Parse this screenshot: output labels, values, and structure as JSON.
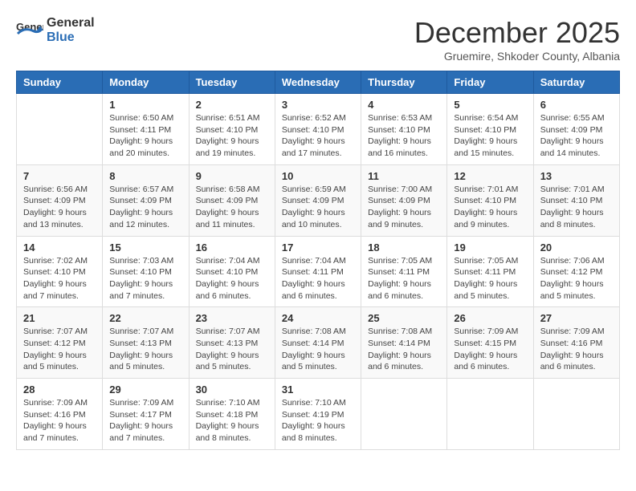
{
  "logo": {
    "general": "General",
    "blue": "Blue"
  },
  "title": "December 2025",
  "subtitle": "Gruemire, Shkoder County, Albania",
  "days_header": [
    "Sunday",
    "Monday",
    "Tuesday",
    "Wednesday",
    "Thursday",
    "Friday",
    "Saturday"
  ],
  "weeks": [
    [
      {
        "day": "",
        "info": ""
      },
      {
        "day": "1",
        "info": "Sunrise: 6:50 AM\nSunset: 4:11 PM\nDaylight: 9 hours\nand 20 minutes."
      },
      {
        "day": "2",
        "info": "Sunrise: 6:51 AM\nSunset: 4:10 PM\nDaylight: 9 hours\nand 19 minutes."
      },
      {
        "day": "3",
        "info": "Sunrise: 6:52 AM\nSunset: 4:10 PM\nDaylight: 9 hours\nand 17 minutes."
      },
      {
        "day": "4",
        "info": "Sunrise: 6:53 AM\nSunset: 4:10 PM\nDaylight: 9 hours\nand 16 minutes."
      },
      {
        "day": "5",
        "info": "Sunrise: 6:54 AM\nSunset: 4:10 PM\nDaylight: 9 hours\nand 15 minutes."
      },
      {
        "day": "6",
        "info": "Sunrise: 6:55 AM\nSunset: 4:09 PM\nDaylight: 9 hours\nand 14 minutes."
      }
    ],
    [
      {
        "day": "7",
        "info": "Sunrise: 6:56 AM\nSunset: 4:09 PM\nDaylight: 9 hours\nand 13 minutes."
      },
      {
        "day": "8",
        "info": "Sunrise: 6:57 AM\nSunset: 4:09 PM\nDaylight: 9 hours\nand 12 minutes."
      },
      {
        "day": "9",
        "info": "Sunrise: 6:58 AM\nSunset: 4:09 PM\nDaylight: 9 hours\nand 11 minutes."
      },
      {
        "day": "10",
        "info": "Sunrise: 6:59 AM\nSunset: 4:09 PM\nDaylight: 9 hours\nand 10 minutes."
      },
      {
        "day": "11",
        "info": "Sunrise: 7:00 AM\nSunset: 4:09 PM\nDaylight: 9 hours\nand 9 minutes."
      },
      {
        "day": "12",
        "info": "Sunrise: 7:01 AM\nSunset: 4:10 PM\nDaylight: 9 hours\nand 9 minutes."
      },
      {
        "day": "13",
        "info": "Sunrise: 7:01 AM\nSunset: 4:10 PM\nDaylight: 9 hours\nand 8 minutes."
      }
    ],
    [
      {
        "day": "14",
        "info": "Sunrise: 7:02 AM\nSunset: 4:10 PM\nDaylight: 9 hours\nand 7 minutes."
      },
      {
        "day": "15",
        "info": "Sunrise: 7:03 AM\nSunset: 4:10 PM\nDaylight: 9 hours\nand 7 minutes."
      },
      {
        "day": "16",
        "info": "Sunrise: 7:04 AM\nSunset: 4:10 PM\nDaylight: 9 hours\nand 6 minutes."
      },
      {
        "day": "17",
        "info": "Sunrise: 7:04 AM\nSunset: 4:11 PM\nDaylight: 9 hours\nand 6 minutes."
      },
      {
        "day": "18",
        "info": "Sunrise: 7:05 AM\nSunset: 4:11 PM\nDaylight: 9 hours\nand 6 minutes."
      },
      {
        "day": "19",
        "info": "Sunrise: 7:05 AM\nSunset: 4:11 PM\nDaylight: 9 hours\nand 5 minutes."
      },
      {
        "day": "20",
        "info": "Sunrise: 7:06 AM\nSunset: 4:12 PM\nDaylight: 9 hours\nand 5 minutes."
      }
    ],
    [
      {
        "day": "21",
        "info": "Sunrise: 7:07 AM\nSunset: 4:12 PM\nDaylight: 9 hours\nand 5 minutes."
      },
      {
        "day": "22",
        "info": "Sunrise: 7:07 AM\nSunset: 4:13 PM\nDaylight: 9 hours\nand 5 minutes."
      },
      {
        "day": "23",
        "info": "Sunrise: 7:07 AM\nSunset: 4:13 PM\nDaylight: 9 hours\nand 5 minutes."
      },
      {
        "day": "24",
        "info": "Sunrise: 7:08 AM\nSunset: 4:14 PM\nDaylight: 9 hours\nand 5 minutes."
      },
      {
        "day": "25",
        "info": "Sunrise: 7:08 AM\nSunset: 4:14 PM\nDaylight: 9 hours\nand 6 minutes."
      },
      {
        "day": "26",
        "info": "Sunrise: 7:09 AM\nSunset: 4:15 PM\nDaylight: 9 hours\nand 6 minutes."
      },
      {
        "day": "27",
        "info": "Sunrise: 7:09 AM\nSunset: 4:16 PM\nDaylight: 9 hours\nand 6 minutes."
      }
    ],
    [
      {
        "day": "28",
        "info": "Sunrise: 7:09 AM\nSunset: 4:16 PM\nDaylight: 9 hours\nand 7 minutes."
      },
      {
        "day": "29",
        "info": "Sunrise: 7:09 AM\nSunset: 4:17 PM\nDaylight: 9 hours\nand 7 minutes."
      },
      {
        "day": "30",
        "info": "Sunrise: 7:10 AM\nSunset: 4:18 PM\nDaylight: 9 hours\nand 8 minutes."
      },
      {
        "day": "31",
        "info": "Sunrise: 7:10 AM\nSunset: 4:19 PM\nDaylight: 9 hours\nand 8 minutes."
      },
      {
        "day": "",
        "info": ""
      },
      {
        "day": "",
        "info": ""
      },
      {
        "day": "",
        "info": ""
      }
    ]
  ]
}
